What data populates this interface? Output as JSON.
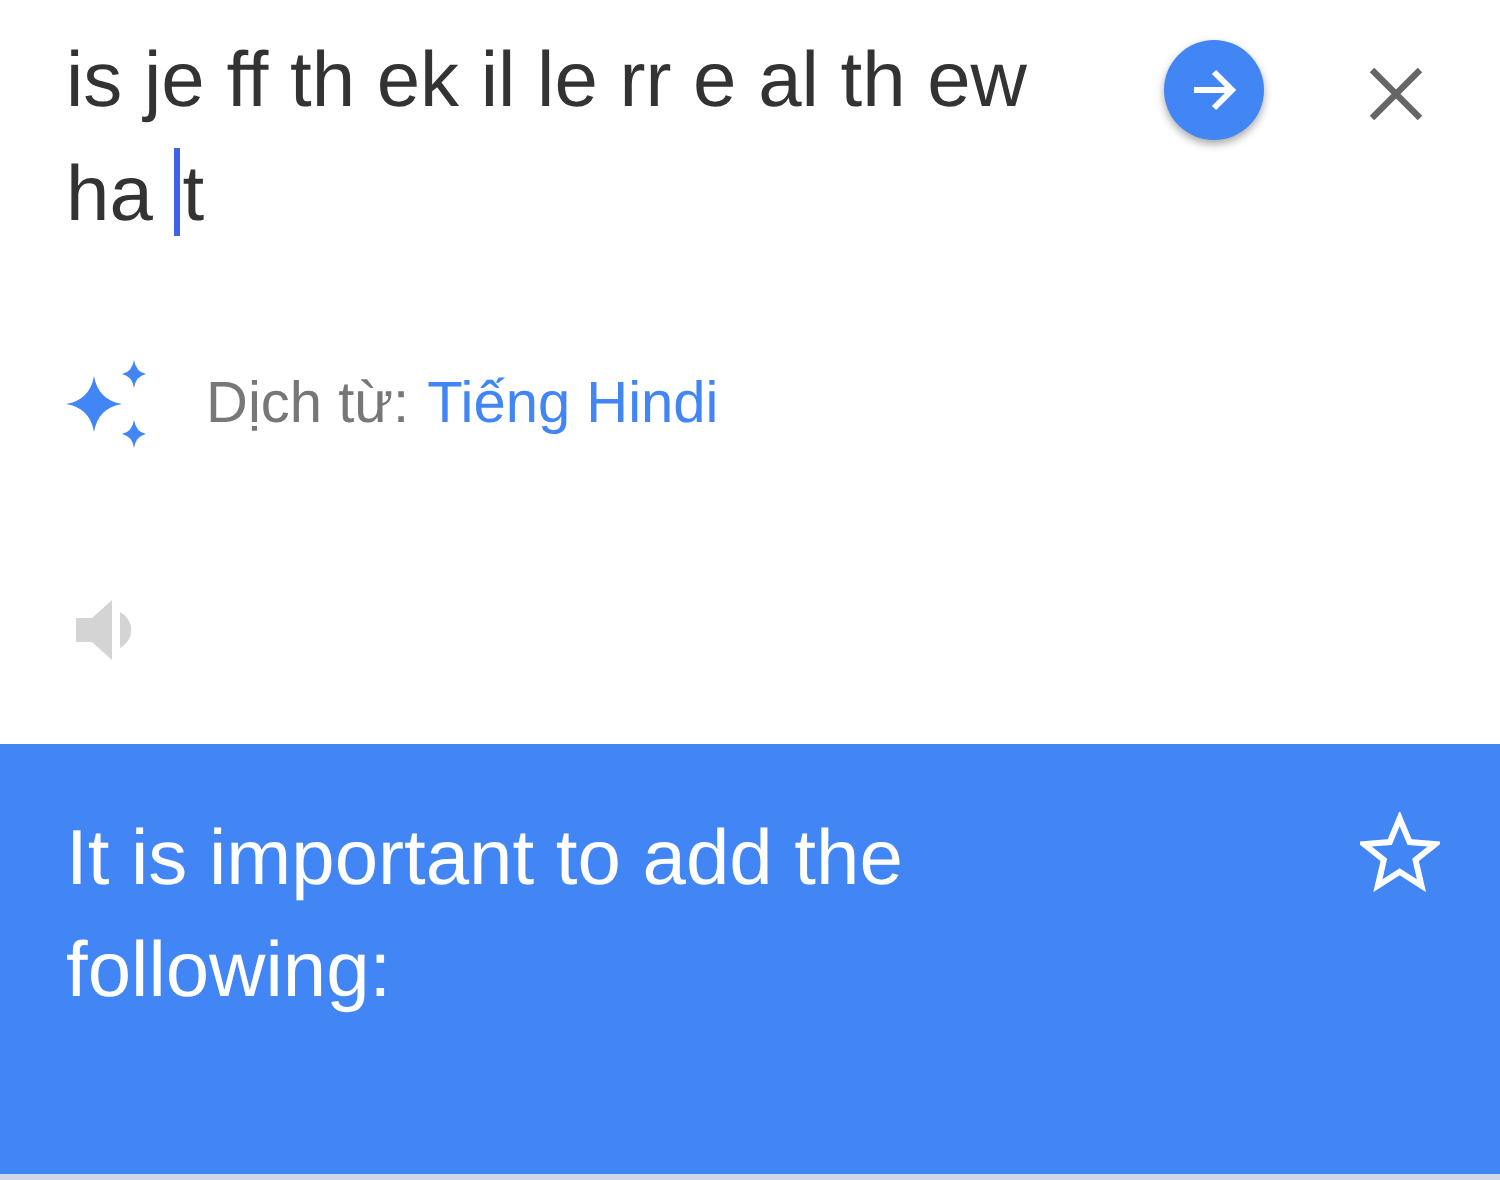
{
  "source_input": {
    "text_before_caret": "is je ff th ek il le rr e al th ew ha ",
    "text_after_caret": "t"
  },
  "detected_language": {
    "label": "Dịch từ:",
    "language": "Tiếng Hindi"
  },
  "speaker": {
    "disabled": true
  },
  "translation": {
    "text": "It is important to add the following:",
    "starred": false
  }
}
